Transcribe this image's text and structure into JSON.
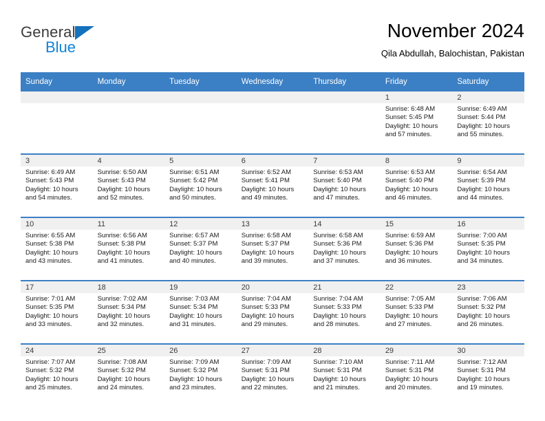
{
  "brand": {
    "name_dark": "General",
    "name_light": "Blue",
    "accent_color": "#1083d6",
    "triangle_color": "#1572bd"
  },
  "header": {
    "title": "November 2024",
    "subtitle": "Qila Abdullah, Balochistan, Pakistan",
    "header_bg_color": "#3b7fc4"
  },
  "weekdays": [
    "Sunday",
    "Monday",
    "Tuesday",
    "Wednesday",
    "Thursday",
    "Friday",
    "Saturday"
  ],
  "weeks": [
    [
      {
        "day": ""
      },
      {
        "day": ""
      },
      {
        "day": ""
      },
      {
        "day": ""
      },
      {
        "day": ""
      },
      {
        "day": "1",
        "sunrise": "Sunrise: 6:48 AM",
        "sunset": "Sunset: 5:45 PM",
        "daylight": "Daylight: 10 hours and 57 minutes."
      },
      {
        "day": "2",
        "sunrise": "Sunrise: 6:49 AM",
        "sunset": "Sunset: 5:44 PM",
        "daylight": "Daylight: 10 hours and 55 minutes."
      }
    ],
    [
      {
        "day": "3",
        "sunrise": "Sunrise: 6:49 AM",
        "sunset": "Sunset: 5:43 PM",
        "daylight": "Daylight: 10 hours and 54 minutes."
      },
      {
        "day": "4",
        "sunrise": "Sunrise: 6:50 AM",
        "sunset": "Sunset: 5:43 PM",
        "daylight": "Daylight: 10 hours and 52 minutes."
      },
      {
        "day": "5",
        "sunrise": "Sunrise: 6:51 AM",
        "sunset": "Sunset: 5:42 PM",
        "daylight": "Daylight: 10 hours and 50 minutes."
      },
      {
        "day": "6",
        "sunrise": "Sunrise: 6:52 AM",
        "sunset": "Sunset: 5:41 PM",
        "daylight": "Daylight: 10 hours and 49 minutes."
      },
      {
        "day": "7",
        "sunrise": "Sunrise: 6:53 AM",
        "sunset": "Sunset: 5:40 PM",
        "daylight": "Daylight: 10 hours and 47 minutes."
      },
      {
        "day": "8",
        "sunrise": "Sunrise: 6:53 AM",
        "sunset": "Sunset: 5:40 PM",
        "daylight": "Daylight: 10 hours and 46 minutes."
      },
      {
        "day": "9",
        "sunrise": "Sunrise: 6:54 AM",
        "sunset": "Sunset: 5:39 PM",
        "daylight": "Daylight: 10 hours and 44 minutes."
      }
    ],
    [
      {
        "day": "10",
        "sunrise": "Sunrise: 6:55 AM",
        "sunset": "Sunset: 5:38 PM",
        "daylight": "Daylight: 10 hours and 43 minutes."
      },
      {
        "day": "11",
        "sunrise": "Sunrise: 6:56 AM",
        "sunset": "Sunset: 5:38 PM",
        "daylight": "Daylight: 10 hours and 41 minutes."
      },
      {
        "day": "12",
        "sunrise": "Sunrise: 6:57 AM",
        "sunset": "Sunset: 5:37 PM",
        "daylight": "Daylight: 10 hours and 40 minutes."
      },
      {
        "day": "13",
        "sunrise": "Sunrise: 6:58 AM",
        "sunset": "Sunset: 5:37 PM",
        "daylight": "Daylight: 10 hours and 39 minutes."
      },
      {
        "day": "14",
        "sunrise": "Sunrise: 6:58 AM",
        "sunset": "Sunset: 5:36 PM",
        "daylight": "Daylight: 10 hours and 37 minutes."
      },
      {
        "day": "15",
        "sunrise": "Sunrise: 6:59 AM",
        "sunset": "Sunset: 5:36 PM",
        "daylight": "Daylight: 10 hours and 36 minutes."
      },
      {
        "day": "16",
        "sunrise": "Sunrise: 7:00 AM",
        "sunset": "Sunset: 5:35 PM",
        "daylight": "Daylight: 10 hours and 34 minutes."
      }
    ],
    [
      {
        "day": "17",
        "sunrise": "Sunrise: 7:01 AM",
        "sunset": "Sunset: 5:35 PM",
        "daylight": "Daylight: 10 hours and 33 minutes."
      },
      {
        "day": "18",
        "sunrise": "Sunrise: 7:02 AM",
        "sunset": "Sunset: 5:34 PM",
        "daylight": "Daylight: 10 hours and 32 minutes."
      },
      {
        "day": "19",
        "sunrise": "Sunrise: 7:03 AM",
        "sunset": "Sunset: 5:34 PM",
        "daylight": "Daylight: 10 hours and 31 minutes."
      },
      {
        "day": "20",
        "sunrise": "Sunrise: 7:04 AM",
        "sunset": "Sunset: 5:33 PM",
        "daylight": "Daylight: 10 hours and 29 minutes."
      },
      {
        "day": "21",
        "sunrise": "Sunrise: 7:04 AM",
        "sunset": "Sunset: 5:33 PM",
        "daylight": "Daylight: 10 hours and 28 minutes."
      },
      {
        "day": "22",
        "sunrise": "Sunrise: 7:05 AM",
        "sunset": "Sunset: 5:33 PM",
        "daylight": "Daylight: 10 hours and 27 minutes."
      },
      {
        "day": "23",
        "sunrise": "Sunrise: 7:06 AM",
        "sunset": "Sunset: 5:32 PM",
        "daylight": "Daylight: 10 hours and 26 minutes."
      }
    ],
    [
      {
        "day": "24",
        "sunrise": "Sunrise: 7:07 AM",
        "sunset": "Sunset: 5:32 PM",
        "daylight": "Daylight: 10 hours and 25 minutes."
      },
      {
        "day": "25",
        "sunrise": "Sunrise: 7:08 AM",
        "sunset": "Sunset: 5:32 PM",
        "daylight": "Daylight: 10 hours and 24 minutes."
      },
      {
        "day": "26",
        "sunrise": "Sunrise: 7:09 AM",
        "sunset": "Sunset: 5:32 PM",
        "daylight": "Daylight: 10 hours and 23 minutes."
      },
      {
        "day": "27",
        "sunrise": "Sunrise: 7:09 AM",
        "sunset": "Sunset: 5:31 PM",
        "daylight": "Daylight: 10 hours and 22 minutes."
      },
      {
        "day": "28",
        "sunrise": "Sunrise: 7:10 AM",
        "sunset": "Sunset: 5:31 PM",
        "daylight": "Daylight: 10 hours and 21 minutes."
      },
      {
        "day": "29",
        "sunrise": "Sunrise: 7:11 AM",
        "sunset": "Sunset: 5:31 PM",
        "daylight": "Daylight: 10 hours and 20 minutes."
      },
      {
        "day": "30",
        "sunrise": "Sunrise: 7:12 AM",
        "sunset": "Sunset: 5:31 PM",
        "daylight": "Daylight: 10 hours and 19 minutes."
      }
    ]
  ]
}
